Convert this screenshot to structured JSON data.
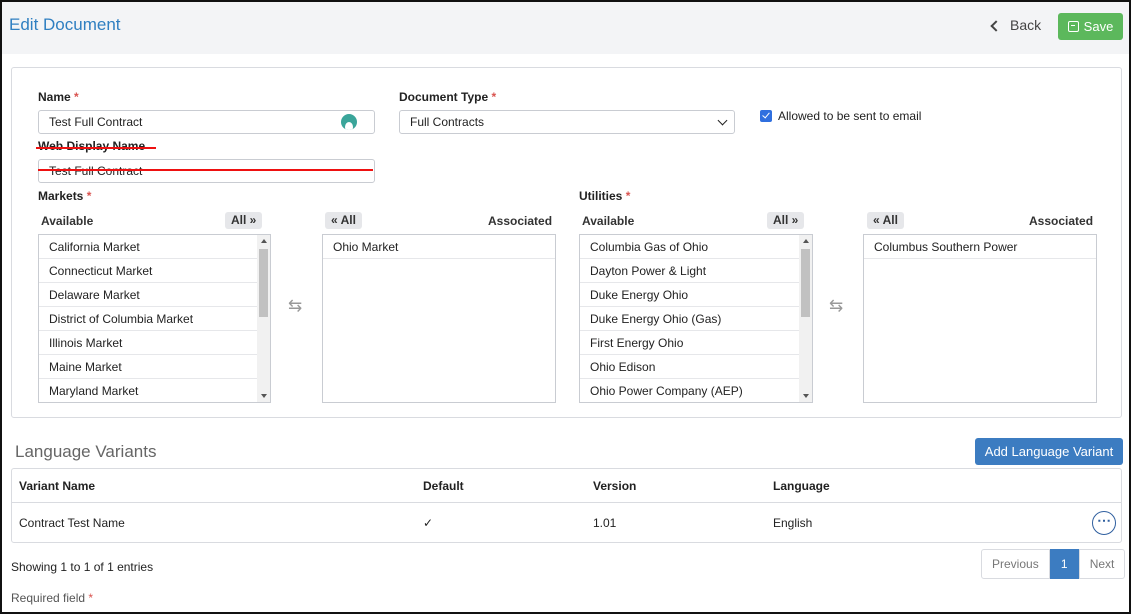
{
  "header": {
    "title": "Edit Document",
    "back_label": "Back",
    "save_label": "Save"
  },
  "form": {
    "name_label": "Name",
    "name_value": "Test Full Contract",
    "doctype_label": "Document Type",
    "doctype_value": "Full Contracts",
    "email_checkbox_label": "Allowed to be sent to email",
    "email_checked": true,
    "web_display_label": "Web Display Name",
    "web_display_value": "Test Full Contract",
    "required_mark": "*"
  },
  "markets": {
    "label": "Markets",
    "available_label": "Available",
    "associated_label": "Associated",
    "all_right_label": "All »",
    "all_left_label": "« All",
    "available": [
      "California Market",
      "Connecticut Market",
      "Delaware Market",
      "District of Columbia Market",
      "Illinois Market",
      "Maine Market",
      "Maryland Market"
    ],
    "associated": [
      "Ohio Market"
    ]
  },
  "utilities": {
    "label": "Utilities",
    "available_label": "Available",
    "associated_label": "Associated",
    "all_right_label": "All »",
    "all_left_label": "« All",
    "available": [
      "Columbia Gas of Ohio",
      "Dayton Power & Light",
      "Duke Energy Ohio",
      "Duke Energy Ohio (Gas)",
      "First Energy Ohio",
      "Ohio Edison",
      "Ohio Power Company (AEP)"
    ],
    "associated": [
      "Columbus Southern Power"
    ]
  },
  "variants": {
    "title": "Language Variants",
    "add_label": "Add Language Variant",
    "columns": [
      "Variant Name",
      "Default",
      "Version",
      "Language"
    ],
    "rows": [
      {
        "name": "Contract Test Name",
        "default": "✓",
        "version": "1.01",
        "language": "English"
      }
    ],
    "more_label": "⋯"
  },
  "pagination": {
    "info": "Showing 1 to 1 of 1 entries",
    "previous": "Previous",
    "current": "1",
    "next": "Next"
  },
  "footer": {
    "required_note": "Required field",
    "required_mark": "*"
  },
  "colors": {
    "accent": "#2f7fc1",
    "save": "#5cb85c",
    "primary": "#3c7cc1",
    "required": "#d9534f"
  }
}
